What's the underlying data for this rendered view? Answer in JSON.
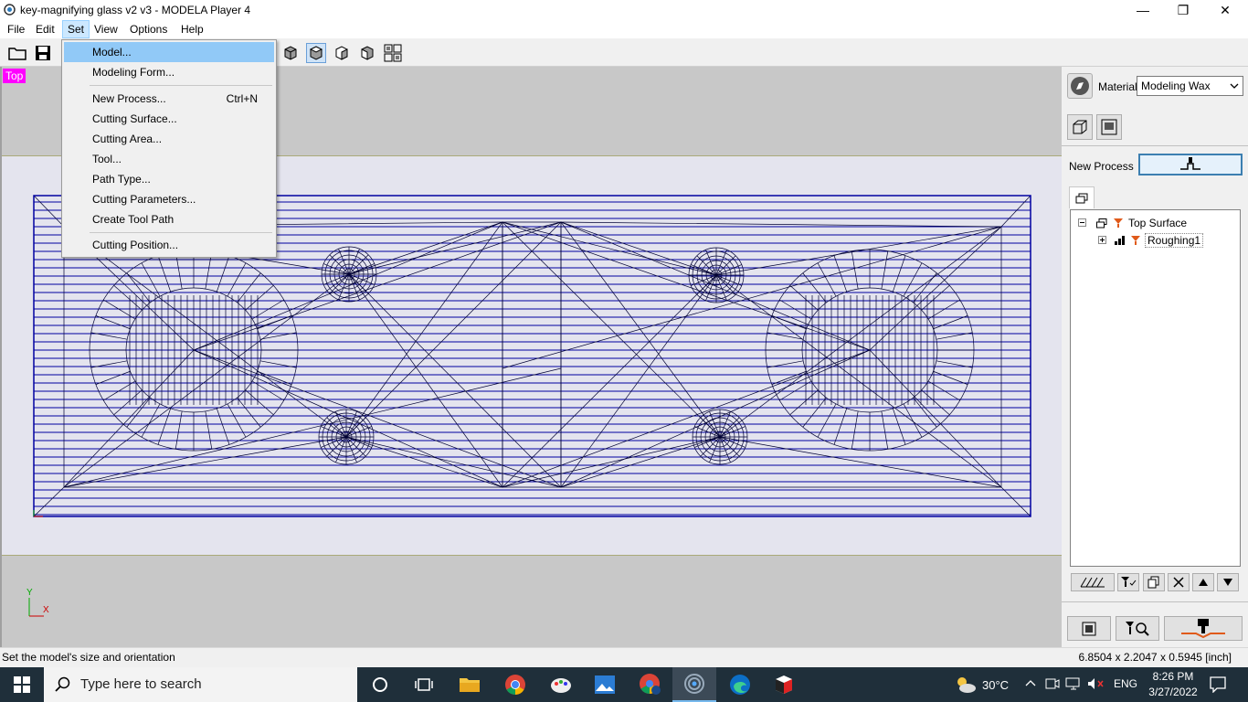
{
  "window": {
    "title": "key-magnifying glass v2 v3 - MODELA Player 4",
    "minimize_glyph": "—",
    "restore_glyph": "❐",
    "close_glyph": "✕"
  },
  "menubar": [
    "File",
    "Edit",
    "Set",
    "View",
    "Options",
    "Help"
  ],
  "view": {
    "label": "Top",
    "axis_y": "Y",
    "axis_x": "X"
  },
  "set_menu": {
    "items": [
      {
        "label": "Model...",
        "shortcut": ""
      },
      {
        "label": "Modeling Form...",
        "shortcut": ""
      },
      {
        "label": "New Process...",
        "shortcut": "Ctrl+N"
      },
      {
        "label": "Cutting Surface...",
        "shortcut": ""
      },
      {
        "label": "Cutting Area...",
        "shortcut": ""
      },
      {
        "label": "Tool...",
        "shortcut": ""
      },
      {
        "label": "Path Type...",
        "shortcut": ""
      },
      {
        "label": "Cutting Parameters...",
        "shortcut": ""
      },
      {
        "label": "Create Tool Path",
        "shortcut": ""
      },
      {
        "label": "Cutting Position...",
        "shortcut": ""
      }
    ]
  },
  "panel": {
    "material_label": "Material",
    "material_value": "Modeling Wax",
    "new_process_label": "New Process",
    "tree": {
      "root": "Top Surface",
      "child": "Roughing1"
    }
  },
  "status": {
    "message": "Set the model's size and orientation",
    "dimensions": "6.8504 x 2.2047 x 0.5945 [inch]"
  },
  "taskbar": {
    "search_placeholder": "Type here to search",
    "temperature": "30°C",
    "language": "ENG",
    "time": "8:26 PM",
    "date": "3/27/2022"
  },
  "colors": {
    "accent": "#91c9f7",
    "wire": "#00008b",
    "view_label_bg": "#ff00ff",
    "taskbar_bg": "#1f2f3a"
  }
}
